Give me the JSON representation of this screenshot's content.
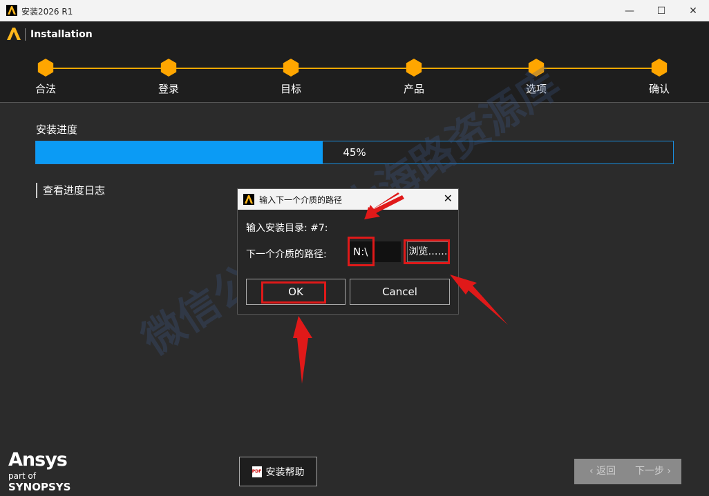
{
  "window": {
    "title": "安装2026 R1"
  },
  "header": {
    "title": "Installation"
  },
  "steps": [
    {
      "label": "合法"
    },
    {
      "label": "登录"
    },
    {
      "label": "目标"
    },
    {
      "label": "产品"
    },
    {
      "label": "选项"
    },
    {
      "label": "确认"
    }
  ],
  "progress": {
    "label": "安装进度",
    "value": 0.45,
    "text": "45%"
  },
  "log_link": "查看进度日志",
  "dialog": {
    "title": "输入下一个介质的路径",
    "line1": "输入安装目录: #7:",
    "path_label": "下一个介质的路径:",
    "path_value": "N:\\",
    "browse_label": "浏览……",
    "ok_label": "OK",
    "cancel_label": "Cancel"
  },
  "watermark": "微信公众号: 大海路资源库",
  "footer": {
    "brand": "Ansys",
    "part_of": "part of",
    "synopsys": "SYNOPSYS",
    "help_label": "安装帮助",
    "back_label": "返回",
    "next_label": "下一步"
  },
  "colors": {
    "accent": "#ffa600",
    "progress": "#0b9bf5",
    "annotation": "#e01919"
  }
}
